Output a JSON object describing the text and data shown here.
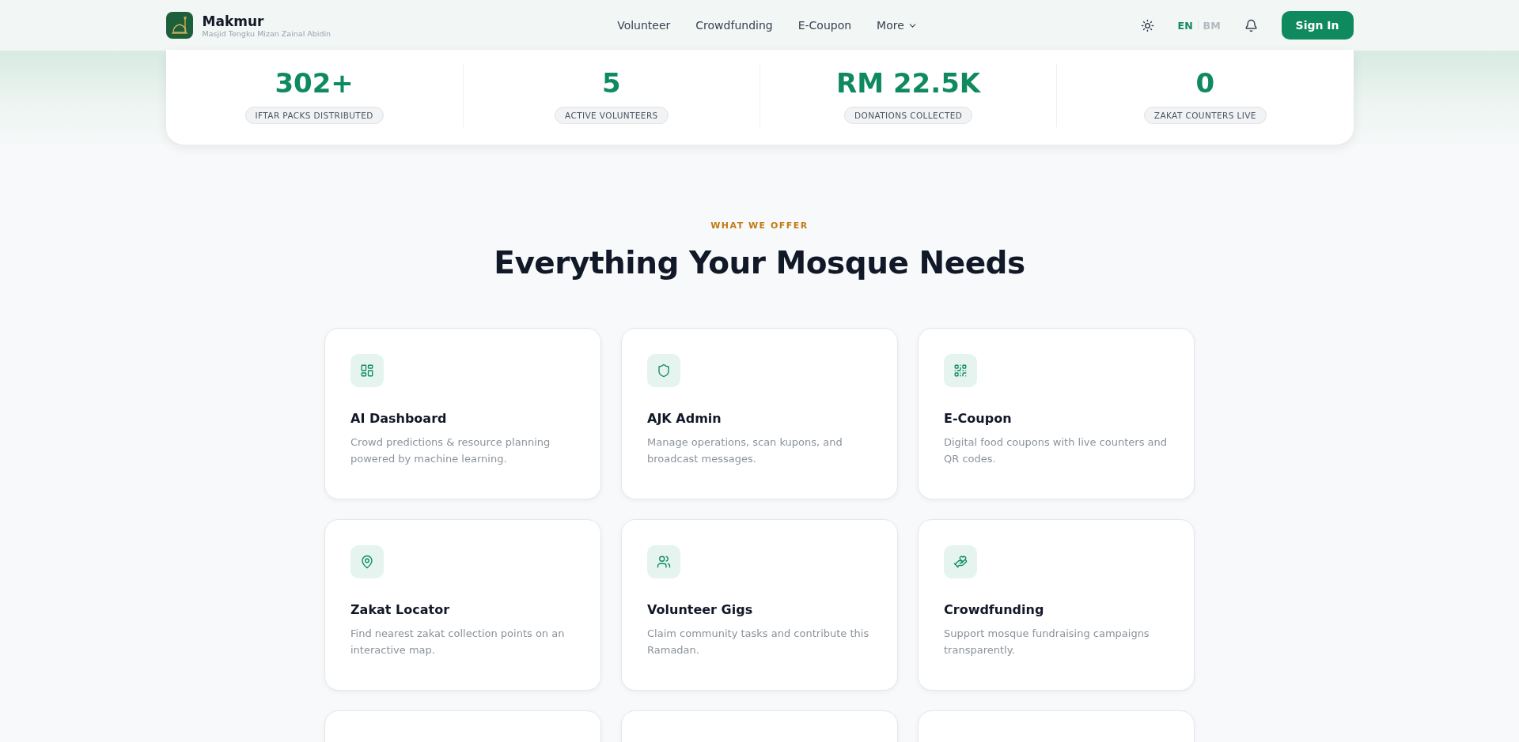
{
  "header": {
    "brand": {
      "name": "Makmur",
      "subtitle": "Masjid Tengku Mizan Zainal Abidin"
    },
    "nav": [
      {
        "label": "Volunteer",
        "kind": "link"
      },
      {
        "label": "Crowdfunding",
        "kind": "link"
      },
      {
        "label": "E-Coupon",
        "kind": "link"
      },
      {
        "label": "More",
        "kind": "dropdown"
      }
    ],
    "languages": [
      {
        "label": "EN",
        "selected": true
      },
      {
        "label": "BM",
        "selected": false
      }
    ],
    "sign_in": "Sign In"
  },
  "stats": [
    {
      "value": "302+",
      "label": "IFTAR PACKS DISTRIBUTED"
    },
    {
      "value": "5",
      "label": "ACTIVE VOLUNTEERS"
    },
    {
      "value": "RM 22.5K",
      "label": "DONATIONS COLLECTED"
    },
    {
      "value": "0",
      "label": "ZAKAT COUNTERS LIVE"
    }
  ],
  "features": {
    "kicker": "WHAT WE OFFER",
    "title": "Everything Your Mosque Needs",
    "cards": [
      {
        "title": "AI Dashboard",
        "description": "Crowd predictions & resource planning powered by machine learning."
      },
      {
        "title": "AJK Admin",
        "description": "Manage operations, scan kupons, and broadcast messages."
      },
      {
        "title": "E-Coupon",
        "description": "Digital food coupons with live counters and QR codes."
      },
      {
        "title": "Zakat Locator",
        "description": "Find nearest zakat collection points on an interactive map."
      },
      {
        "title": "Volunteer Gigs",
        "description": "Claim community tasks and contribute this Ramadan."
      },
      {
        "title": "Crowdfunding",
        "description": "Support mosque fundraising campaigns transparently."
      }
    ]
  }
}
